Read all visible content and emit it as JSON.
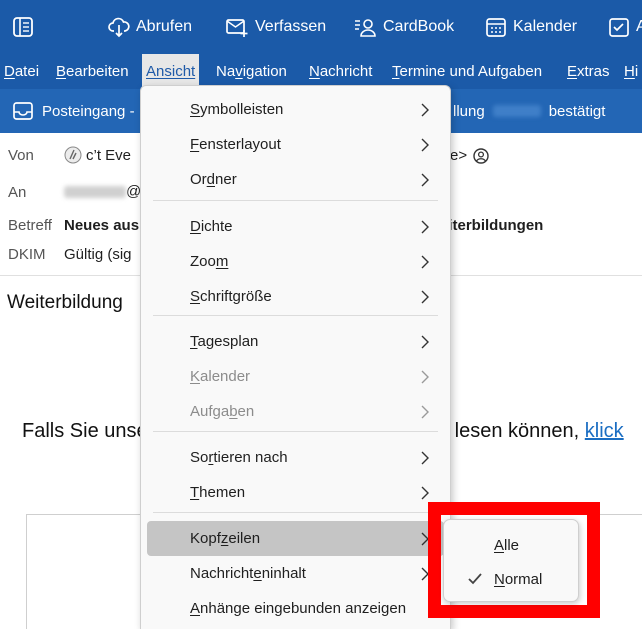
{
  "toolbar": {
    "buttons": [
      {
        "label": ""
      },
      {
        "label": "Abrufen"
      },
      {
        "label": "Verfassen"
      },
      {
        "label": "CardBook"
      },
      {
        "label": "Kalender"
      },
      {
        "label": "A"
      }
    ]
  },
  "menubar": {
    "items": [
      {
        "label": "Datei",
        "key": "D",
        "rest": "atei"
      },
      {
        "label": "Bearbeiten",
        "key": "B",
        "rest": "earbeiten"
      },
      {
        "label": "Ansicht",
        "key": "A",
        "rest": "nsicht"
      },
      {
        "pre": "Na",
        "key": "v",
        "rest": "igation"
      },
      {
        "label": "Nachricht",
        "key": "N",
        "rest": "achricht"
      },
      {
        "label": "Termine und Aufgaben",
        "key": "T",
        "rest": "ermine und Aufgaben"
      },
      {
        "label": "Extras",
        "key": "E",
        "rest": "xtras"
      },
      {
        "label": "Hi",
        "key": "H",
        "rest": "i"
      }
    ]
  },
  "tabbar": {
    "inbox_label": "Posteingang -",
    "tab_fragment_1": "llung",
    "tab_fragment_2": "bestätigt"
  },
  "header": {
    "from_label": "Von",
    "from_value": "c’t Eve",
    "from_tail": "e>",
    "to_label": "An",
    "to_at": "@",
    "subject_label": "Betreff",
    "subject_value": "Neues aus",
    "subject_tail": "eiterbildungen",
    "dkim_label": "DKIM",
    "dkim_value": "Gültig (sig"
  },
  "body": {
    "title": "Weiterbildung",
    "line_start": "Falls Sie unse",
    "line_end": "e lesen können,",
    "link_text": "klick"
  },
  "menu": {
    "items": [
      {
        "pre": "",
        "key": "S",
        "rest": "ymbolleisten",
        "disabled": false,
        "hover": false
      },
      {
        "pre": "",
        "key": "F",
        "rest": "ensterlayout",
        "disabled": false,
        "hover": false
      },
      {
        "pre": "Or",
        "key": "d",
        "rest": "ner",
        "disabled": false,
        "hover": false
      },
      {
        "pre": "",
        "key": "D",
        "rest": "ichte",
        "disabled": false,
        "hover": false
      },
      {
        "pre": "Zoo",
        "key": "m",
        "rest": "",
        "disabled": false,
        "hover": false
      },
      {
        "pre": "",
        "key": "S",
        "rest": "chriftgröße",
        "disabled": false,
        "hover": false
      },
      {
        "pre": "",
        "key": "T",
        "rest": "agesplan",
        "disabled": false,
        "hover": false
      },
      {
        "pre": "",
        "key": "K",
        "rest": "alender",
        "disabled": true,
        "hover": false
      },
      {
        "pre": "Aufga",
        "key": "b",
        "rest": "en",
        "disabled": true,
        "hover": false
      },
      {
        "pre": "So",
        "key": "r",
        "rest": "tieren nach",
        "disabled": false,
        "hover": false
      },
      {
        "pre": "",
        "key": "T",
        "rest": "hemen",
        "disabled": false,
        "hover": false
      },
      {
        "pre": "Kopf",
        "key": "z",
        "rest": "eilen",
        "disabled": false,
        "hover": true
      },
      {
        "pre": "Nachricht",
        "key": "e",
        "rest": "ninhalt",
        "disabled": false,
        "hover": false
      },
      {
        "pre": "",
        "key": "A",
        "rest": "nhänge eingebunden anzeigen",
        "disabled": false,
        "hover": false
      }
    ]
  },
  "submenu": {
    "items": [
      {
        "key": "A",
        "rest": "lle",
        "checked": false
      },
      {
        "key": "N",
        "rest": "ormal",
        "checked": true
      }
    ]
  },
  "colors": {
    "toolbar_bg": "#1b5aa8",
    "tabbar_bg": "#2366b5",
    "highlight": "#ff0000",
    "link": "#1a6dc2"
  }
}
